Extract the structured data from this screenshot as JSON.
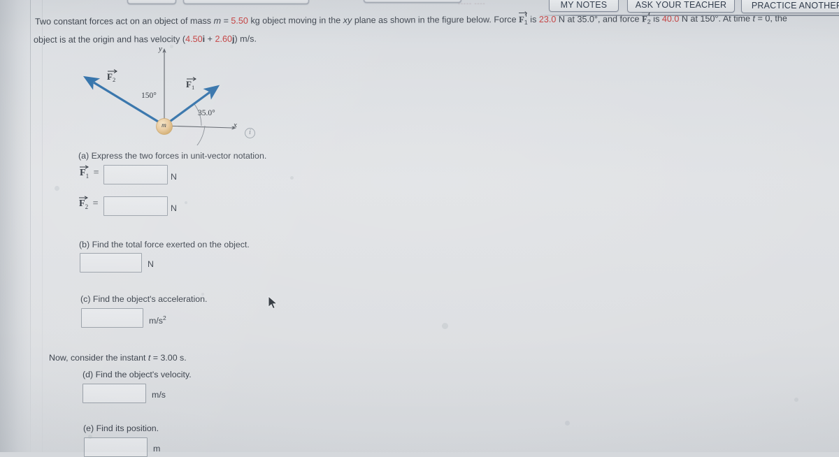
{
  "toolbar": {
    "my_notes": "MY NOTES",
    "ask_your_teacher": "ASK YOUR TEACHER",
    "practice_another": "PRACTICE ANOTHER",
    "ghost_text": "----- ----"
  },
  "question": {
    "line1_a": "Two constant forces act on an object of mass ",
    "line1_m_sym": "m",
    "line1_eq": " = ",
    "line1_mass": "5.50",
    "line1_b": " kg object moving in the ",
    "line1_xy": "xy",
    "line1_c": " plane as shown in the figure below. Force ",
    "line1_F1": "F",
    "line1_F1_sub": "1",
    "line1_d": " is ",
    "line1_F1_mag": "23.0",
    "line1_e": " N at 35.0°, and force ",
    "line1_F2": "F",
    "line1_F2_sub": "2",
    "line1_f": " is ",
    "line1_F2_mag": "40.0",
    "line1_g": " N at 150°. At time ",
    "line1_t": "t",
    "line1_h": " = 0, the",
    "line2_a": "object is at the origin and has velocity (",
    "line2_vx": "4.50",
    "line2_i": "i",
    "line2_plus": " + ",
    "line2_vy": "2.60",
    "line2_j": "j",
    "line2_b": ") m/s."
  },
  "figure": {
    "axis_y_label": "y",
    "axis_x_label": "x",
    "mass_label": "m",
    "f1_label": "F",
    "f1_sub": "1",
    "f2_label": "F",
    "f2_sub": "2",
    "angle1": "35.0°",
    "angle2": "150°",
    "info_icon": "i",
    "arrow_color": "#2f6fa8",
    "mass_color": "#e2c08a"
  },
  "parts": [
    {
      "id": "a",
      "prompt": "(a) Express the two forces in unit-vector notation.",
      "rows": [
        {
          "lhs_F": "F",
          "lhs_sub": "1",
          "lhs_eq": "=",
          "value": "",
          "unit": "N"
        },
        {
          "lhs_F": "F",
          "lhs_sub": "2",
          "lhs_eq": "=",
          "value": "",
          "unit": "N"
        }
      ]
    },
    {
      "id": "b",
      "prompt": "(b) Find the total force exerted on the object.",
      "rows": [
        {
          "value": "",
          "unit": "N"
        }
      ]
    },
    {
      "id": "c",
      "prompt": "(c) Find the object's acceleration.",
      "rows": [
        {
          "value": "",
          "unit": "m/s",
          "unit_sup": "2"
        }
      ]
    }
  ],
  "instant": {
    "text_a": "Now, consider the instant ",
    "text_t": "t",
    "text_b": " = 3.00 s."
  },
  "parts2": [
    {
      "id": "d",
      "prompt": "(d) Find the object's velocity.",
      "rows": [
        {
          "value": "",
          "unit": "m/s"
        }
      ]
    },
    {
      "id": "e",
      "prompt": "(e) Find its position.",
      "rows": [
        {
          "value": "",
          "unit": "m"
        }
      ]
    }
  ],
  "colors": {
    "page_bg": "#dcdee1",
    "text": "#3c434d",
    "accent_red": "#c23c3c",
    "vector_blue": "#2f6fa8",
    "button_border": "#7e8694"
  }
}
